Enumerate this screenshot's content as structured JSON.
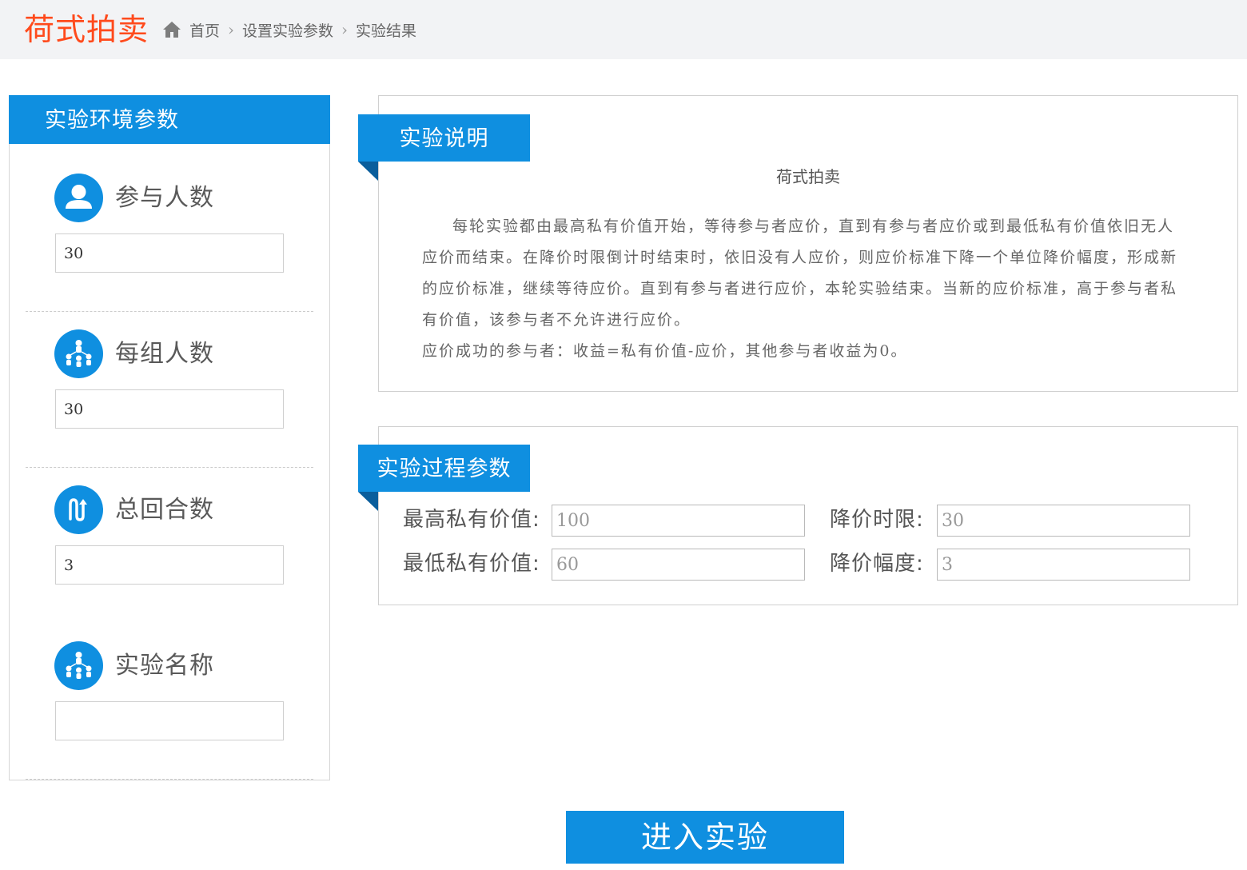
{
  "header": {
    "brand": "荷式拍卖",
    "breadcrumb": [
      "首页",
      "设置实验参数",
      "实验结果"
    ]
  },
  "env_panel": {
    "title": "实验环境参数",
    "params": [
      {
        "label": "参与人数",
        "value": "30",
        "icon": "person-icon"
      },
      {
        "label": "每组人数",
        "value": "30",
        "icon": "group-icon"
      },
      {
        "label": "总回合数",
        "value": "3",
        "icon": "rounds-icon"
      },
      {
        "label": "实验名称",
        "value": "",
        "icon": "group-icon"
      }
    ]
  },
  "description": {
    "ribbon": "实验说明",
    "title": "荷式拍卖",
    "paragraph1": "每轮实验都由最高私有价值开始，等待参与者应价，直到有参与者应价或到最低私有价值依旧无人应价而结束。在降价时限倒计时结束时，依旧没有人应价，则应价标准下降一个单位降价幅度，形成新的应价标准，继续等待应价。直到有参与者进行应价，本轮实验结束。当新的应价标准，高于参与者私有价值，该参与者不允许进行应价。",
    "paragraph2": "应价成功的参与者：收益=私有价值-应价，其他参与者收益为0。"
  },
  "process": {
    "ribbon": "实验过程参数",
    "max_value_label": "最高私有价值:",
    "max_value": "100",
    "min_value_label": "最低私有价值:",
    "min_value": "60",
    "time_limit_label": "降价时限:",
    "time_limit": "30",
    "step_label": "降价幅度:",
    "step": "3"
  },
  "actions": {
    "enter_label": "进入实验"
  },
  "colors": {
    "accent": "#0f8fe0",
    "brand": "#ff4a1c",
    "header_bg": "#f2f3f5"
  }
}
